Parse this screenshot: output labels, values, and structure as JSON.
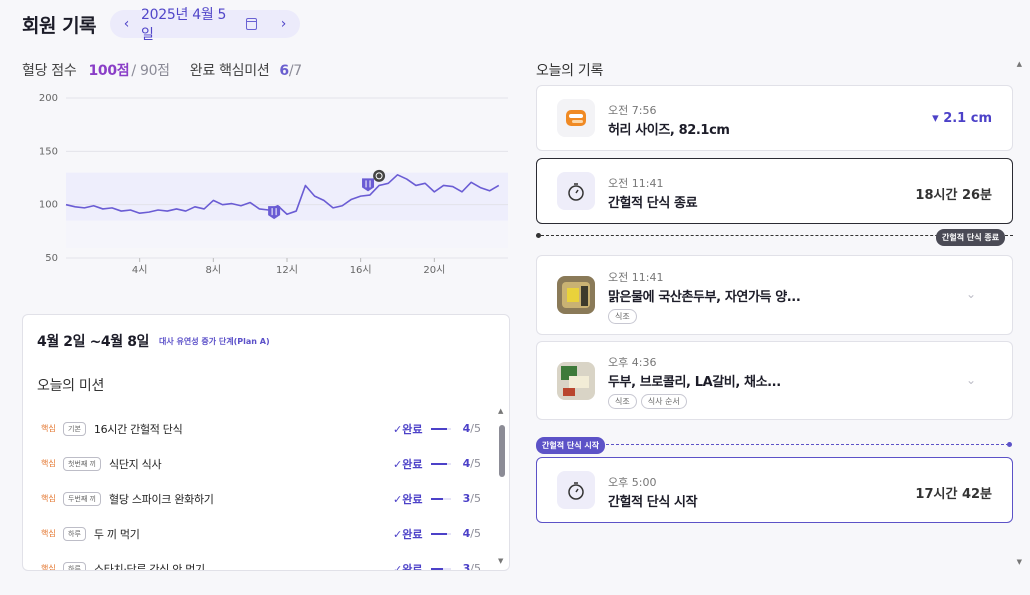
{
  "header": {
    "title": "회원 기록",
    "date": "2025년 4월 5일",
    "prev_icon": "chevron-left-icon",
    "next_icon": "chevron-right-icon",
    "calendar_icon": "calendar-icon"
  },
  "score": {
    "label": "혈당 점수",
    "value": "100점",
    "total": "/ 90점",
    "mission_label": "완료 핵심미션",
    "mission_value": "6",
    "mission_total": "/7"
  },
  "chart_data": {
    "type": "line",
    "yticks": [
      200,
      150,
      100,
      50
    ],
    "xticks": [
      "4시",
      "8시",
      "12시",
      "16시",
      "20시"
    ],
    "ylim": [
      50,
      200
    ],
    "xlim": [
      0,
      24
    ],
    "target_band": [
      85,
      130
    ],
    "series": [
      {
        "x": [
          0,
          0.5,
          1,
          1.5,
          2,
          2.5,
          3,
          3.5,
          4,
          4.5,
          5,
          5.5,
          6,
          6.5,
          7,
          7.5,
          8,
          8.5,
          9,
          9.5,
          10,
          10.5,
          11,
          11.5,
          12,
          12.5,
          13,
          13.5,
          14,
          14.5,
          15,
          15.5,
          16,
          16.5,
          17,
          17.5,
          18,
          18.5,
          19,
          19.5,
          20,
          20.5,
          21,
          21.5,
          22,
          22.5,
          23,
          23.5
        ],
        "y": [
          100,
          98,
          97,
          99,
          96,
          97,
          94,
          95,
          92,
          93,
          95,
          94,
          96,
          94,
          98,
          96,
          104,
          100,
          101,
          99,
          102,
          96,
          95,
          99,
          91,
          94,
          118,
          108,
          104,
          97,
          99,
          105,
          108,
          109,
          118,
          120,
          128,
          124,
          118,
          120,
          112,
          118,
          117,
          112,
          121,
          116,
          113,
          118
        ]
      }
    ],
    "markers": [
      {
        "x": 11.3,
        "y": 93,
        "icon": "meal-icon"
      },
      {
        "x": 16.4,
        "y": 119,
        "icon": "meal-icon"
      },
      {
        "x": 17.0,
        "y": 127,
        "icon": "timer-icon"
      }
    ]
  },
  "mission": {
    "range": "4월 2일 ~4월 8일",
    "stage": "대사 유연성 증가 단계(Plan A)",
    "subtitle": "오늘의 미션",
    "items": [
      {
        "core": "핵심",
        "tag": "기본",
        "name": "16시간 간헐적 단식",
        "done": "완료",
        "count": "4",
        "total": "/5",
        "progress": 0.8
      },
      {
        "core": "핵심",
        "tag": "첫번째 끼",
        "name": "식단지 식사",
        "done": "완료",
        "count": "4",
        "total": "/5",
        "progress": 0.8
      },
      {
        "core": "핵심",
        "tag": "두번째 끼",
        "name": "혈당 스파이크 완화하기",
        "done": "완료",
        "count": "3",
        "total": "/5",
        "progress": 0.6
      },
      {
        "core": "핵심",
        "tag": "하루",
        "name": "두 끼 먹기",
        "done": "완료",
        "count": "4",
        "total": "/5",
        "progress": 0.8
      },
      {
        "core": "핵심",
        "tag": "하루",
        "name": "스타치·당류 간식 안 먹기",
        "done": "완료",
        "count": "3",
        "total": "/5",
        "progress": 0.6
      }
    ]
  },
  "records": {
    "title": "오늘의 기록",
    "cards": [
      {
        "time": "오전 7:56",
        "main": "허리 사이즈, 82.1cm",
        "value": "▾ 2.1 cm",
        "icon": "tape-measure-icon"
      },
      {
        "time": "오전 11:41",
        "main": "간헐적 단식 종료",
        "value": "18시간 26분",
        "icon": "stopwatch-icon"
      },
      {
        "time": "오전 11:41",
        "main": "맑은물에 국산촌두부, 자연가득 양...",
        "tags": [
          "식조"
        ],
        "icon": "food-photo-icon"
      },
      {
        "time": "오후 4:36",
        "main": "두부, 브로콜리, LA갈비, 채소...",
        "tags": [
          "식조",
          "식사 순서"
        ],
        "icon": "food-photo-icon"
      },
      {
        "time": "오후 5:00",
        "main": "간헐적 단식 시작",
        "value": "17시간 42분",
        "icon": "stopwatch-icon"
      }
    ],
    "fast_end_pill": "간헐적 단식 종료",
    "fast_start_pill": "간헐적 단식 시작"
  }
}
